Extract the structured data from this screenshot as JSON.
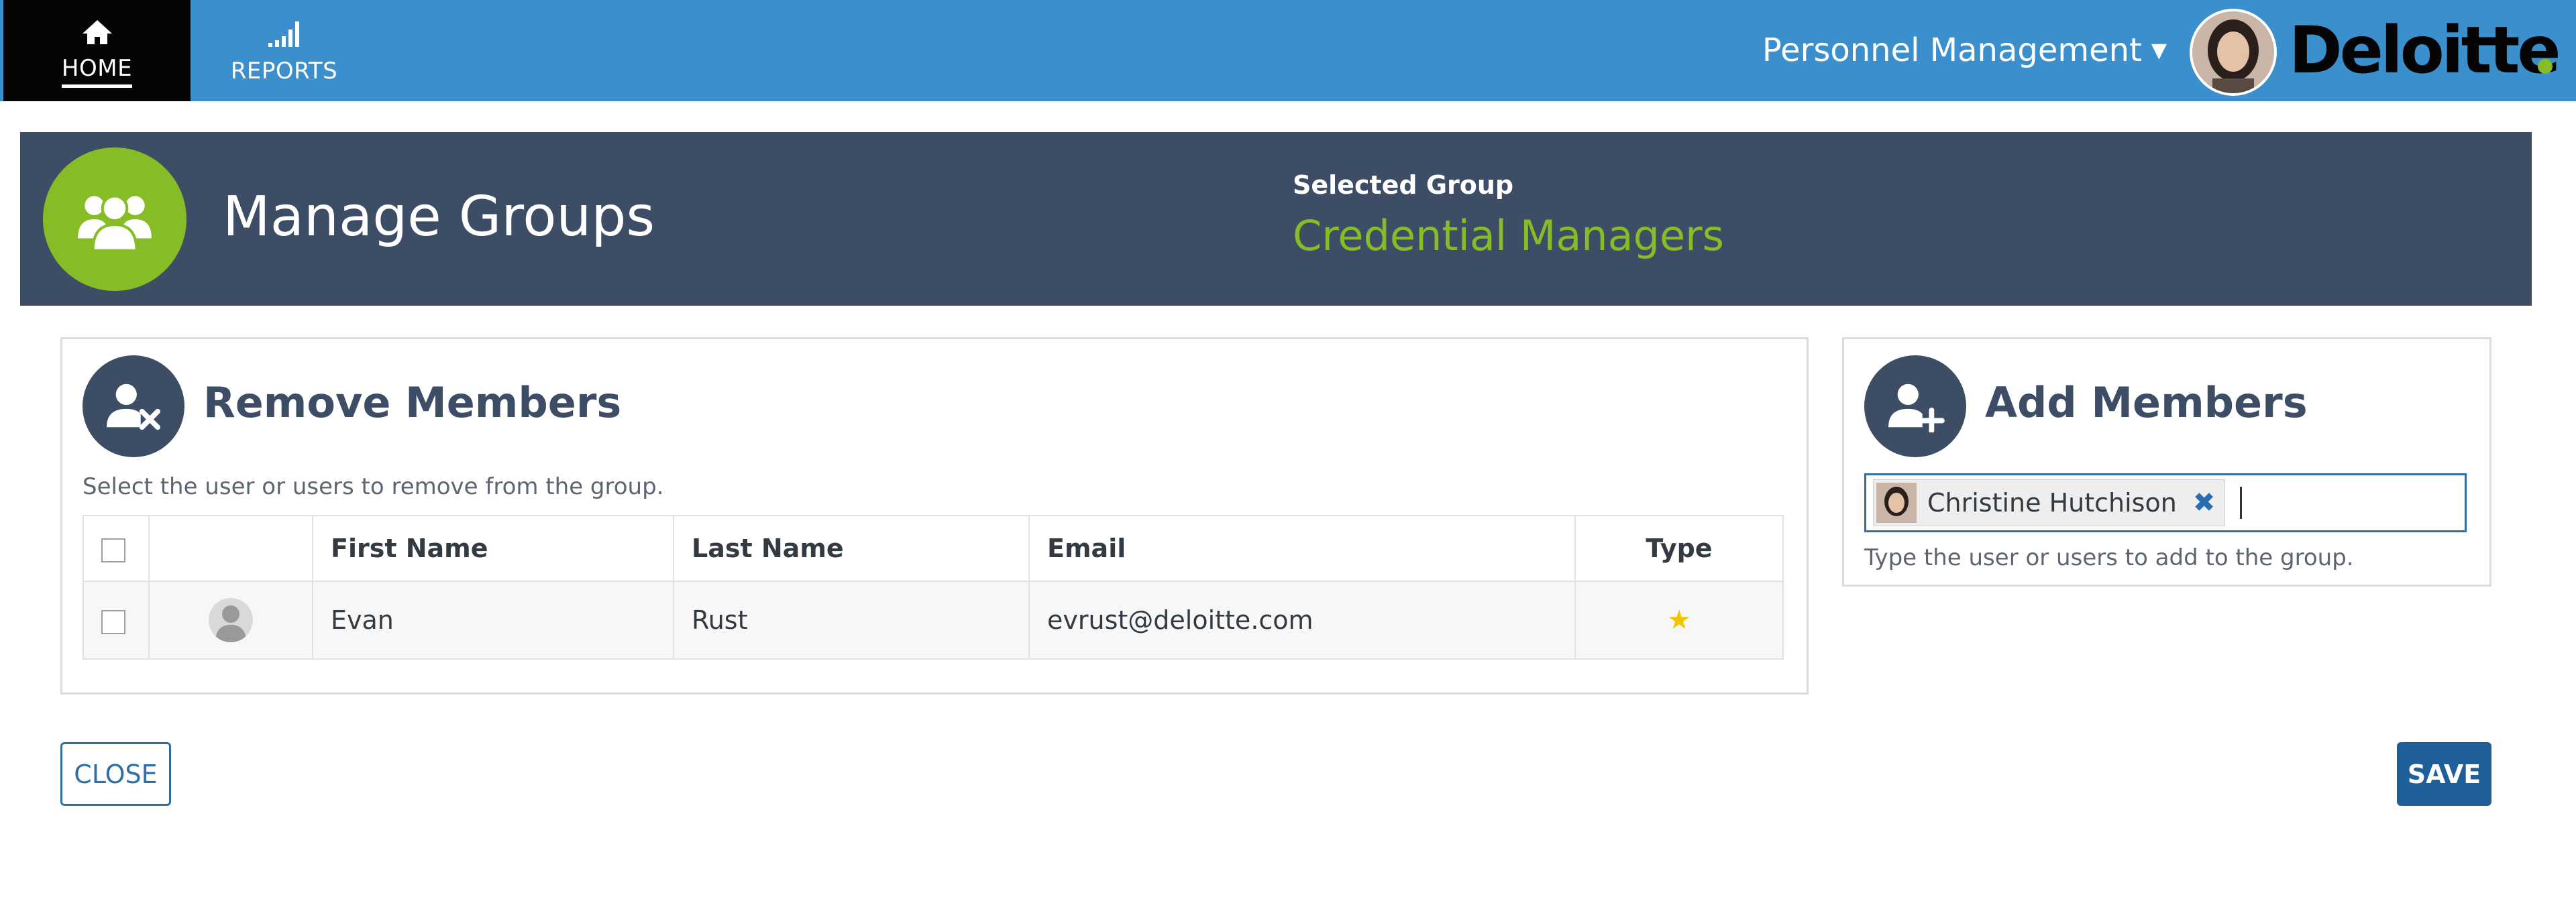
{
  "nav": {
    "home_label": "HOME",
    "home_icon": "home-icon",
    "reports_label": "REPORTS",
    "reports_icon": "signal-bars-icon"
  },
  "header": {
    "workspace_label": "Personnel Management",
    "workspace_icon": "chevron-down-icon",
    "logo_text": "Deloitte",
    "accent": "#86bc25",
    "nav_color": "#3a8fcc"
  },
  "band": {
    "title": "Manage Groups",
    "icon": "users-group-icon",
    "selected_label": "Selected Group",
    "selected_value": "Credential Managers",
    "bg_color": "#3d4d66"
  },
  "remove_panel": {
    "title": "Remove Members",
    "icon": "user-remove-icon",
    "hint": "Select the user or users to remove from the group.",
    "columns": [
      "",
      "",
      "First Name",
      "Last Name",
      "Email",
      "Type"
    ],
    "rows": [
      {
        "first_name": "Evan",
        "last_name": "Rust",
        "email": "evrust@deloitte.com",
        "type_icon": "star-icon"
      }
    ]
  },
  "add_panel": {
    "title": "Add Members",
    "icon": "user-add-icon",
    "tags": [
      "Christine Hutchison"
    ],
    "hint": "Type the user or users to add to the group."
  },
  "buttons": {
    "close_label": "CLOSE",
    "save_label": "SAVE"
  }
}
